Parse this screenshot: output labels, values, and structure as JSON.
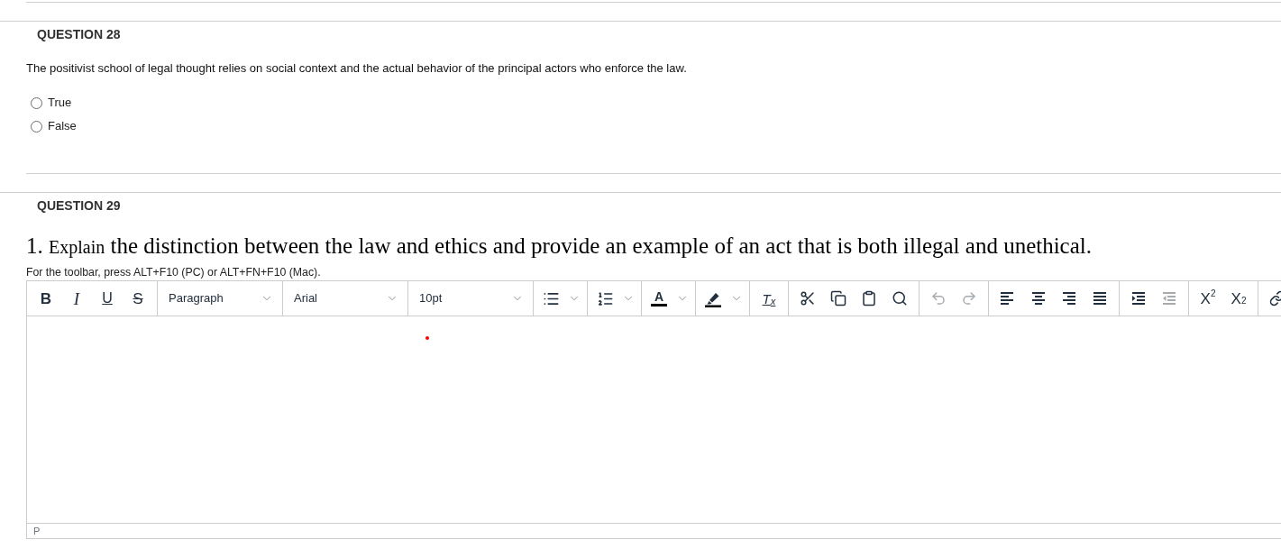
{
  "questions": [
    {
      "heading": "QUESTION 28",
      "kind": "true_false",
      "text": "The positivist school of legal thought relies on social context and the actual behavior of the principal actors who enforce the law.",
      "options": [
        {
          "label": "True",
          "selected": false
        },
        {
          "label": "False",
          "selected": false
        }
      ]
    },
    {
      "heading": "QUESTION 29",
      "kind": "essay",
      "prompt": [
        {
          "text": "1. ",
          "small": false
        },
        {
          "text": "Explain",
          "small": true
        },
        {
          "text": " the distinction between the law and ethics and provide an example of an act that is both illegal and unethical.",
          "small": false
        }
      ],
      "hint": "For the toolbar, press ALT+F10 (PC) or ALT+FN+F10 (Mac).",
      "editor": {
        "toolbar": [
          [
            {
              "kind": "bold",
              "label": "B",
              "disabled": false
            },
            {
              "kind": "italic",
              "label": "I",
              "disabled": false
            },
            {
              "kind": "underline",
              "label": "U",
              "disabled": false
            },
            {
              "kind": "strikethrough",
              "label": "S",
              "disabled": false
            }
          ],
          [
            {
              "kind": "block_format",
              "value": "Paragraph",
              "disabled": false
            }
          ],
          [
            {
              "kind": "font_family",
              "value": "Arial",
              "disabled": false
            }
          ],
          [
            {
              "kind": "font_size",
              "value": "10pt",
              "disabled": false
            }
          ],
          [
            {
              "kind": "bullet_list",
              "disabled": false
            }
          ],
          [
            {
              "kind": "numbered_list",
              "disabled": false
            }
          ],
          [
            {
              "kind": "text_color",
              "label": "A",
              "disabled": false
            }
          ],
          [
            {
              "kind": "highlight",
              "disabled": false
            }
          ],
          [
            {
              "kind": "remove_format",
              "label": "T$_{x}$",
              "disabled": false
            }
          ],
          [
            {
              "kind": "cut",
              "disabled": false
            },
            {
              "kind": "copy",
              "disabled": false
            },
            {
              "kind": "paste",
              "disabled": false
            },
            {
              "kind": "find",
              "disabled": false
            }
          ],
          [
            {
              "kind": "undo",
              "disabled": true
            },
            {
              "kind": "redo",
              "disabled": true
            }
          ],
          [
            {
              "kind": "align_left",
              "disabled": false
            },
            {
              "kind": "align_center",
              "disabled": false
            },
            {
              "kind": "align_right",
              "disabled": false
            },
            {
              "kind": "justify",
              "disabled": false
            }
          ],
          [
            {
              "kind": "indent",
              "disabled": false
            },
            {
              "kind": "outdent",
              "disabled": true
            }
          ],
          [
            {
              "kind": "superscript",
              "label": "X$^{2}$",
              "disabled": false
            },
            {
              "kind": "subscript",
              "label": "X$_{2}$",
              "disabled": false
            }
          ],
          [
            {
              "kind": "link",
              "disabled": false
            }
          ]
        ],
        "cursor_mark": true,
        "status_path": "P"
      }
    }
  ]
}
